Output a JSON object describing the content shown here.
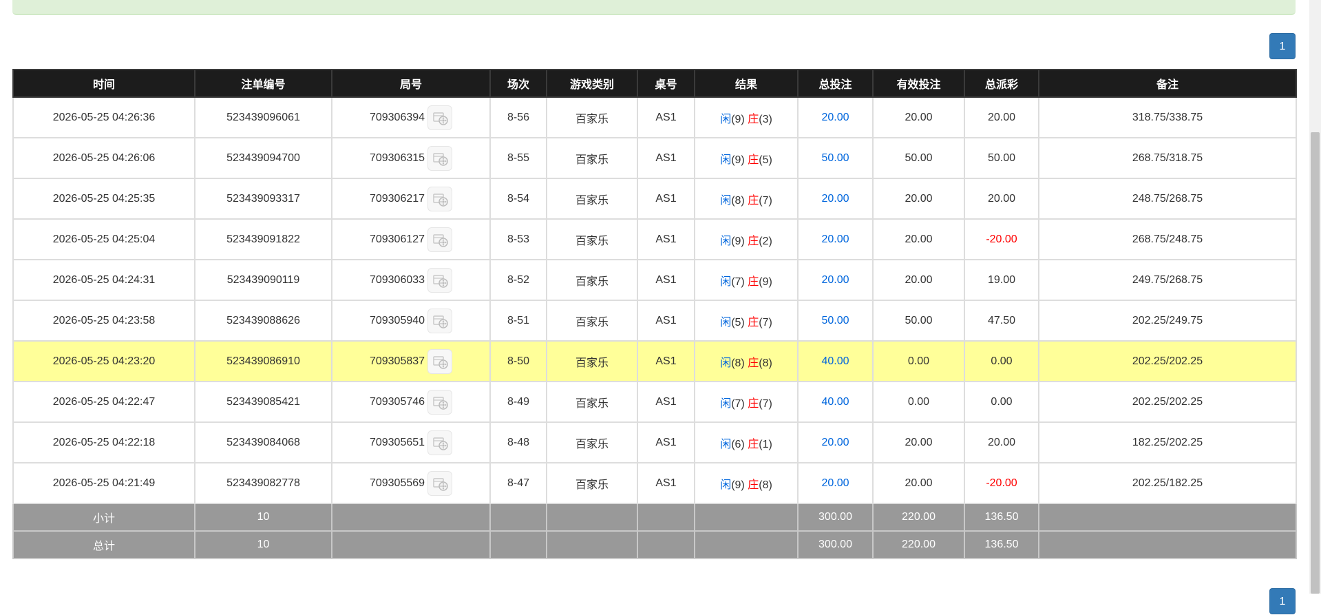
{
  "pagination": {
    "current_page": "1"
  },
  "table": {
    "headers": [
      "时间",
      "注单编号",
      "局号",
      "场次",
      "游戏类别",
      "桌号",
      "结果",
      "总投注",
      "有效投注",
      "总派彩",
      "备注"
    ],
    "rows": [
      {
        "time": "2026-05-25 04:26:36",
        "bet_no": "523439096061",
        "round": "709306394",
        "session": "8-56",
        "game": "百家乐",
        "table": "AS1",
        "player_label": "闲",
        "player_score": "(9)",
        "banker_label": "庄",
        "banker_score": "(3)",
        "total_bet": "20.00",
        "valid_bet": "20.00",
        "payout": "20.00",
        "payout_negative": false,
        "note": "318.75/338.75",
        "highlight": false
      },
      {
        "time": "2026-05-25 04:26:06",
        "bet_no": "523439094700",
        "round": "709306315",
        "session": "8-55",
        "game": "百家乐",
        "table": "AS1",
        "player_label": "闲",
        "player_score": "(9)",
        "banker_label": "庄",
        "banker_score": "(5)",
        "total_bet": "50.00",
        "valid_bet": "50.00",
        "payout": "50.00",
        "payout_negative": false,
        "note": "268.75/318.75",
        "highlight": false
      },
      {
        "time": "2026-05-25 04:25:35",
        "bet_no": "523439093317",
        "round": "709306217",
        "session": "8-54",
        "game": "百家乐",
        "table": "AS1",
        "player_label": "闲",
        "player_score": "(8)",
        "banker_label": "庄",
        "banker_score": "(7)",
        "total_bet": "20.00",
        "valid_bet": "20.00",
        "payout": "20.00",
        "payout_negative": false,
        "note": "248.75/268.75",
        "highlight": false
      },
      {
        "time": "2026-05-25 04:25:04",
        "bet_no": "523439091822",
        "round": "709306127",
        "session": "8-53",
        "game": "百家乐",
        "table": "AS1",
        "player_label": "闲",
        "player_score": "(9)",
        "banker_label": "庄",
        "banker_score": "(2)",
        "total_bet": "20.00",
        "valid_bet": "20.00",
        "payout": "-20.00",
        "payout_negative": true,
        "note": "268.75/248.75",
        "highlight": false
      },
      {
        "time": "2026-05-25 04:24:31",
        "bet_no": "523439090119",
        "round": "709306033",
        "session": "8-52",
        "game": "百家乐",
        "table": "AS1",
        "player_label": "闲",
        "player_score": "(7)",
        "banker_label": "庄",
        "banker_score": "(9)",
        "total_bet": "20.00",
        "valid_bet": "20.00",
        "payout": "19.00",
        "payout_negative": false,
        "note": "249.75/268.75",
        "highlight": false
      },
      {
        "time": "2026-05-25 04:23:58",
        "bet_no": "523439088626",
        "round": "709305940",
        "session": "8-51",
        "game": "百家乐",
        "table": "AS1",
        "player_label": "闲",
        "player_score": "(5)",
        "banker_label": "庄",
        "banker_score": "(7)",
        "total_bet": "50.00",
        "valid_bet": "50.00",
        "payout": "47.50",
        "payout_negative": false,
        "note": "202.25/249.75",
        "highlight": false
      },
      {
        "time": "2026-05-25 04:23:20",
        "bet_no": "523439086910",
        "round": "709305837",
        "session": "8-50",
        "game": "百家乐",
        "table": "AS1",
        "player_label": "闲",
        "player_score": "(8)",
        "banker_label": "庄",
        "banker_score": "(8)",
        "total_bet": "40.00",
        "valid_bet": "0.00",
        "payout": "0.00",
        "payout_negative": false,
        "note": "202.25/202.25",
        "highlight": true
      },
      {
        "time": "2026-05-25 04:22:47",
        "bet_no": "523439085421",
        "round": "709305746",
        "session": "8-49",
        "game": "百家乐",
        "table": "AS1",
        "player_label": "闲",
        "player_score": "(7)",
        "banker_label": "庄",
        "banker_score": "(7)",
        "total_bet": "40.00",
        "valid_bet": "0.00",
        "payout": "0.00",
        "payout_negative": false,
        "note": "202.25/202.25",
        "highlight": false
      },
      {
        "time": "2026-05-25 04:22:18",
        "bet_no": "523439084068",
        "round": "709305651",
        "session": "8-48",
        "game": "百家乐",
        "table": "AS1",
        "player_label": "闲",
        "player_score": "(6)",
        "banker_label": "庄",
        "banker_score": "(1)",
        "total_bet": "20.00",
        "valid_bet": "20.00",
        "payout": "20.00",
        "payout_negative": false,
        "note": "182.25/202.25",
        "highlight": false
      },
      {
        "time": "2026-05-25 04:21:49",
        "bet_no": "523439082778",
        "round": "709305569",
        "session": "8-47",
        "game": "百家乐",
        "table": "AS1",
        "player_label": "闲",
        "player_score": "(9)",
        "banker_label": "庄",
        "banker_score": "(8)",
        "total_bet": "20.00",
        "valid_bet": "20.00",
        "payout": "-20.00",
        "payout_negative": true,
        "note": "202.25/182.25",
        "highlight": false
      }
    ],
    "subtotal": {
      "label": "小计",
      "count": "10",
      "total_bet": "300.00",
      "valid_bet": "220.00",
      "payout": "136.50"
    },
    "grand_total": {
      "label": "总计",
      "count": "10",
      "total_bet": "300.00",
      "valid_bet": "220.00",
      "payout": "136.50"
    }
  },
  "colors": {
    "header_bg": "#1c1c1c",
    "highlight_row": "#ffff99",
    "summary_bg": "#999999",
    "player_blue": "#0066dd",
    "banker_red": "#ff0000",
    "page_button": "#337ab7"
  },
  "icons": {
    "replay": "film-reel-icon"
  }
}
